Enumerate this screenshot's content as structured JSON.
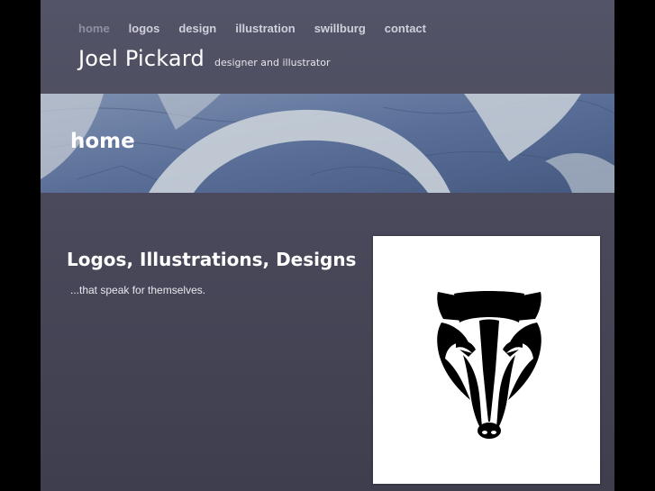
{
  "nav": {
    "items": [
      {
        "label": "home",
        "active": true
      },
      {
        "label": "logos",
        "active": false
      },
      {
        "label": "design",
        "active": false
      },
      {
        "label": "illustration",
        "active": false
      },
      {
        "label": "swillburg",
        "active": false
      },
      {
        "label": "contact",
        "active": false
      }
    ]
  },
  "header": {
    "name": "Joel Pickard",
    "tagline": "designer and illustrator"
  },
  "banner": {
    "title": "home"
  },
  "main": {
    "title": "Logos, Illustrations, Designs",
    "subtitle": "...that speak for themselves."
  },
  "featured_logo": {
    "icon": "badger-head-icon"
  },
  "colors": {
    "page_bg": "#4a4a5c",
    "outer_bg": "#000000",
    "banner_blue": "#5d729a",
    "nav_text": "#cfd0dc",
    "nav_active": "#8e8fa0"
  }
}
